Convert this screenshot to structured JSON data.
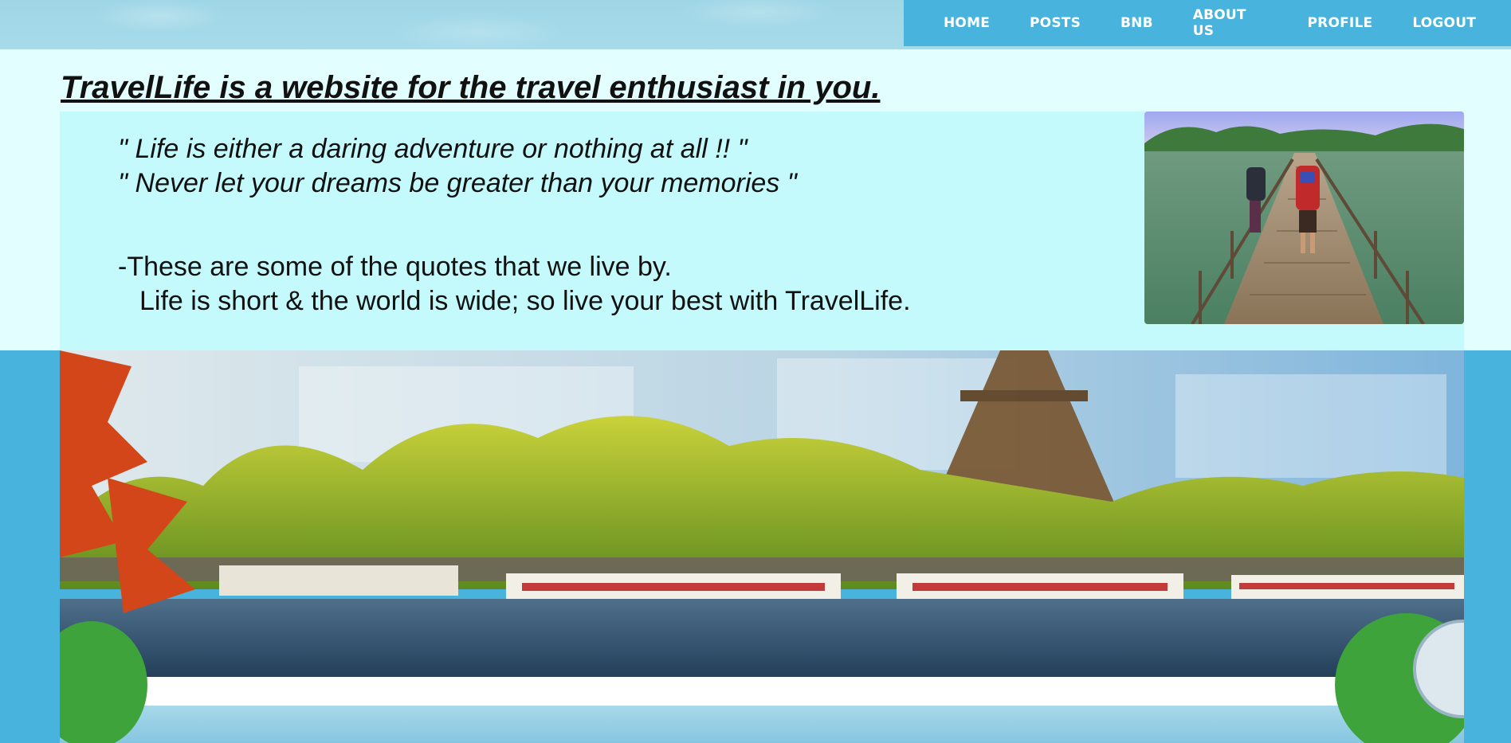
{
  "nav": {
    "items": [
      {
        "label": "HOME"
      },
      {
        "label": "POSTS"
      },
      {
        "label": "BNB"
      },
      {
        "label": "ABOUT US"
      },
      {
        "label": "PROFILE"
      },
      {
        "label": "LOGOUT"
      }
    ]
  },
  "hero": {
    "headline": "TravelLife is a website for the travel enthusiast in you.",
    "quotes": [
      "\" Life is either a daring adventure or nothing at all !! \"",
      "\" Never let your dreams be greater than your memories \""
    ],
    "motto_line1": "-These are some of the quotes that we live by.",
    "motto_line2": "Life is short & the world is wide; so live your best with TravelLife."
  },
  "colors": {
    "nav_bg": "#48b4de",
    "header_bg": "#e3fefe",
    "quote_box_bg": "#c4fafb",
    "page_bg": "#48b4de"
  }
}
